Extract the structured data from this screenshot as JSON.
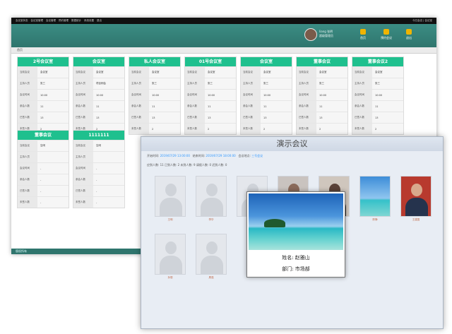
{
  "top_nav": {
    "items": [
      "会议室状态",
      "会议室管理",
      "会议管理",
      "预约管理",
      "数据统计",
      "系统设置",
      "退出"
    ],
    "right": "今日会议 | 会议室"
  },
  "header": {
    "user_name": "liang 张明",
    "user_role": "超级管理员",
    "buttons": [
      "首页",
      "预约会议",
      "退出"
    ]
  },
  "breadcrumb": "首页",
  "cards": [
    {
      "title": "2号会议室",
      "rows": [
        [
          "当前会议",
          "会议室"
        ],
        [
          "主持人员",
          "张三"
        ],
        [
          "会议时间",
          "10:00"
        ],
        [
          "参会人数",
          "11"
        ],
        [
          "已签人数",
          "13"
        ],
        [
          "未签人数",
          "2"
        ]
      ]
    },
    {
      "title": "会议室",
      "rows": [
        [
          "当前会议",
          "会议室"
        ],
        [
          "主持人员",
          "项目例会"
        ],
        [
          "会议时间",
          "10:00"
        ],
        [
          "参会人数",
          "11"
        ],
        [
          "已签人数",
          "13"
        ],
        [
          "未签人数",
          "2"
        ]
      ]
    },
    {
      "title": "私人会议室",
      "rows": [
        [
          "当前会议",
          "会议室"
        ],
        [
          "主持人员",
          "张三"
        ],
        [
          "会议时间",
          "10:00"
        ],
        [
          "参会人数",
          "11"
        ],
        [
          "已签人数",
          "13"
        ],
        [
          "未签人数",
          "2"
        ]
      ]
    },
    {
      "title": "01号会议室",
      "rows": [
        [
          "当前会议",
          "会议室"
        ],
        [
          "主持人员",
          "张三"
        ],
        [
          "会议时间",
          "10:00"
        ],
        [
          "参会人数",
          "11"
        ],
        [
          "已签人数",
          "13"
        ],
        [
          "未签人数",
          "2"
        ]
      ]
    },
    {
      "title": "会议室",
      "rows": [
        [
          "当前会议",
          "会议室"
        ],
        [
          "主持人员",
          "张三"
        ],
        [
          "会议时间",
          "10:00"
        ],
        [
          "参会人数",
          "11"
        ],
        [
          "已签人数",
          "13"
        ],
        [
          "未签人数",
          "2"
        ]
      ]
    },
    {
      "title": "董事会议",
      "rows": [
        [
          "当前会议",
          "会议室"
        ],
        [
          "主持人员",
          "张三"
        ],
        [
          "会议时间",
          "10:00"
        ],
        [
          "参会人数",
          "11"
        ],
        [
          "已签人数",
          "13"
        ],
        [
          "未签人数",
          "2"
        ]
      ]
    },
    {
      "title": "董事会议2",
      "rows": [
        [
          "当前会议",
          "会议室"
        ],
        [
          "主持人员",
          "张三"
        ],
        [
          "会议时间",
          "10:00"
        ],
        [
          "参会人数",
          "11"
        ],
        [
          "已签人数",
          "13"
        ],
        [
          "未签人数",
          "2"
        ]
      ]
    },
    {
      "title": "董事会议",
      "rows": [
        [
          "当前会议",
          "空闲"
        ],
        [
          "主持人员",
          ""
        ],
        [
          "会议时间",
          "-"
        ],
        [
          "参会人数",
          "-"
        ],
        [
          "已签人数",
          "-"
        ],
        [
          "未签人数",
          "-"
        ]
      ]
    },
    {
      "title": "1111111",
      "rows": [
        [
          "当前会议",
          "空闲"
        ],
        [
          "主持人员",
          ""
        ],
        [
          "会议时间",
          "-"
        ],
        [
          "参会人数",
          "-"
        ],
        [
          "已签人数",
          "-"
        ],
        [
          "未签人数",
          "-"
        ]
      ]
    }
  ],
  "footer": "版权所有",
  "meeting": {
    "title": "演示会议",
    "start_label": "开始时间:",
    "start": "2019/07/29 13:00:00",
    "end_label": "结束时间:",
    "end": "2019/07/29 18:00:00",
    "room_label": "会议地点:",
    "room": "三号会议",
    "stats": "应到人数: 11    已到人数: 2    未到人数: 9    请假人数: 0    迟到人数: 0",
    "people": [
      "王明",
      "李华",
      "张伟",
      "赵雅山",
      "刘芳",
      "陈静",
      "王建国",
      "孙丽",
      "周强"
    ],
    "popup_name": "姓名: 赵雅山",
    "popup_dept": "部门: 市场部"
  },
  "colors": {
    "teal": "#2f756d",
    "green": "#1fc08e",
    "blue": "#3399ff"
  }
}
